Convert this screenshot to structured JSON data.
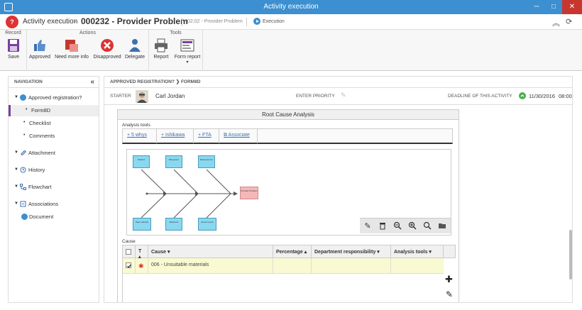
{
  "window": {
    "title": "Activity execution",
    "minimize": "─",
    "maximize": "□",
    "close": "✕"
  },
  "header": {
    "logo": "?",
    "crumb1": "Activity execution",
    "sep": "›",
    "crumb2": "000232 - Provider Problem",
    "step": "02:02 - Provider Problem",
    "status": "Execution",
    "collapse_icon": "︽",
    "refresh_icon": "⟳"
  },
  "ribbon": {
    "groups": {
      "record": "Record",
      "actions": "Actions",
      "tools": "Tools"
    },
    "buttons": {
      "save": "Save",
      "approved": "Approved",
      "need_more_info": "Need more info",
      "disapproved": "Disapproved",
      "delegate": "Delegate",
      "report": "Report",
      "form_report": "Form report"
    }
  },
  "nav": {
    "title": "NAVIGATION",
    "collapse": "«",
    "items": [
      {
        "label": "Approved registration?"
      },
      {
        "label": "Form8D"
      },
      {
        "label": "Checklist"
      },
      {
        "label": "Comments"
      },
      {
        "label": "Attachment"
      },
      {
        "label": "History"
      },
      {
        "label": "Flowchart"
      },
      {
        "label": "Associations"
      },
      {
        "label": "Document"
      }
    ]
  },
  "main": {
    "breadcrumb": "APPROVED REGISTRATION?  ❯  FORM8D",
    "starter_label": "STARTER",
    "starter_name": "Carl Jordan",
    "priority_label": "ENTER PRIORITY",
    "deadline_label": "DEADLINE OF THIS ACTIVITY",
    "deadline_date": "11/30/2016",
    "deadline_time": "08:00"
  },
  "rca": {
    "title": "Root Cause Analysis",
    "tools_label": "Analysis tools",
    "tabs": [
      "+ 5 whys",
      "+ Ishikawa",
      "+ FTA",
      "⧉ Associate"
    ],
    "boxes_top": [
      "Method",
      "Manpower",
      "Measurement"
    ],
    "boxes_bottom": [
      "Raw material",
      "Machines",
      "Environment"
    ],
    "effect": "Provider Problem",
    "toolbar_icons": [
      "edit-icon",
      "delete-icon",
      "zoom-out-icon",
      "zoom-in-icon",
      "search-icon",
      "folder-icon"
    ]
  },
  "cause": {
    "label": "Cause",
    "columns": [
      "T",
      "Cause",
      "Percentage",
      "Department responsibility",
      "Analysis tools"
    ],
    "rows": [
      {
        "cause": "006 - Unsuitable materials",
        "percentage": "",
        "department": "",
        "tools": ""
      }
    ],
    "add_icon": "✚",
    "edit_icon": "✎"
  }
}
